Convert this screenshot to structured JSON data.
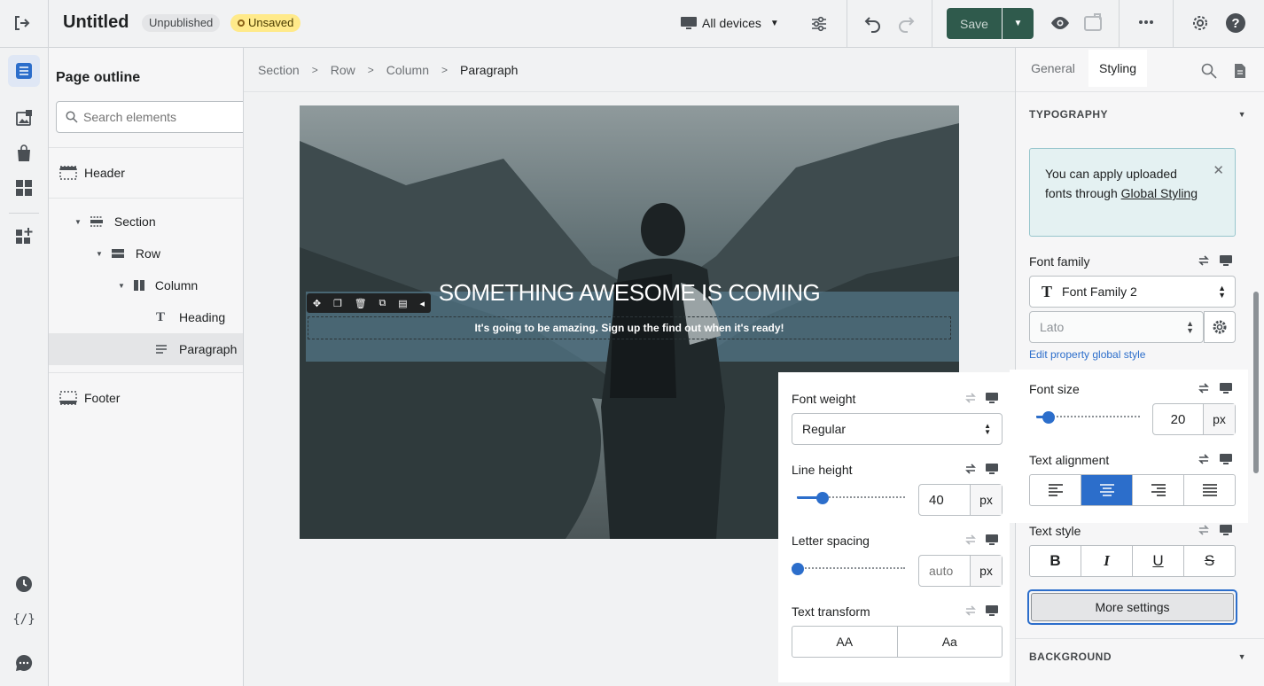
{
  "topbar": {
    "title": "Untitled",
    "badge_unpublished": "Unpublished",
    "badge_unsaved": "Unsaved",
    "device_select": "All devices",
    "save_label": "Save"
  },
  "outline": {
    "title": "Page outline",
    "search_placeholder": "Search elements",
    "items": {
      "header": "Header",
      "section": "Section",
      "row": "Row",
      "column": "Column",
      "heading": "Heading",
      "paragraph": "Paragraph",
      "footer": "Footer"
    }
  },
  "breadcrumb": [
    "Section",
    "Row",
    "Column",
    "Paragraph"
  ],
  "canvas": {
    "heading": "SOMETHING AWESOME IS COMING",
    "paragraph": "It's going to be amazing. Sign up the find out when it's ready!"
  },
  "panel": {
    "tabs": [
      "General",
      "Styling"
    ],
    "active_tab": "Styling",
    "section_typography": "TYPOGRAPHY",
    "notice_text": "You can apply uploaded fonts through ",
    "notice_link": "Global Styling",
    "font_family_label": "Font family",
    "font_family_value": "Font Family 2",
    "font_sub_value": "Lato",
    "edit_global_link": "Edit property global style",
    "font_size_label": "Font size",
    "font_size_value": "20",
    "font_size_unit": "px",
    "font_size_level": 0.07,
    "text_alignment_label": "Text alignment",
    "text_alignment_active": "center",
    "text_style_label": "Text style",
    "text_style_buttons": [
      "B",
      "I",
      "U",
      "S"
    ],
    "more_settings": "More settings",
    "section_background": "BACKGROUND"
  },
  "popover": {
    "font_weight_label": "Font weight",
    "font_weight_value": "Regular",
    "line_height_label": "Line height",
    "line_height_value": "40",
    "line_height_unit": "px",
    "line_height_level": 0.2,
    "letter_spacing_label": "Letter spacing",
    "letter_spacing_placeholder": "auto",
    "letter_spacing_unit": "px",
    "letter_spacing_level": 0.0,
    "text_transform_label": "Text transform",
    "text_transform_options": [
      "AA",
      "Aa"
    ]
  },
  "colors": {
    "accent": "#2c6ecb",
    "save_button": "#2f5a4c",
    "unsaved_badge": "#ffea8a",
    "notice_bg": "#e4f1f2"
  }
}
